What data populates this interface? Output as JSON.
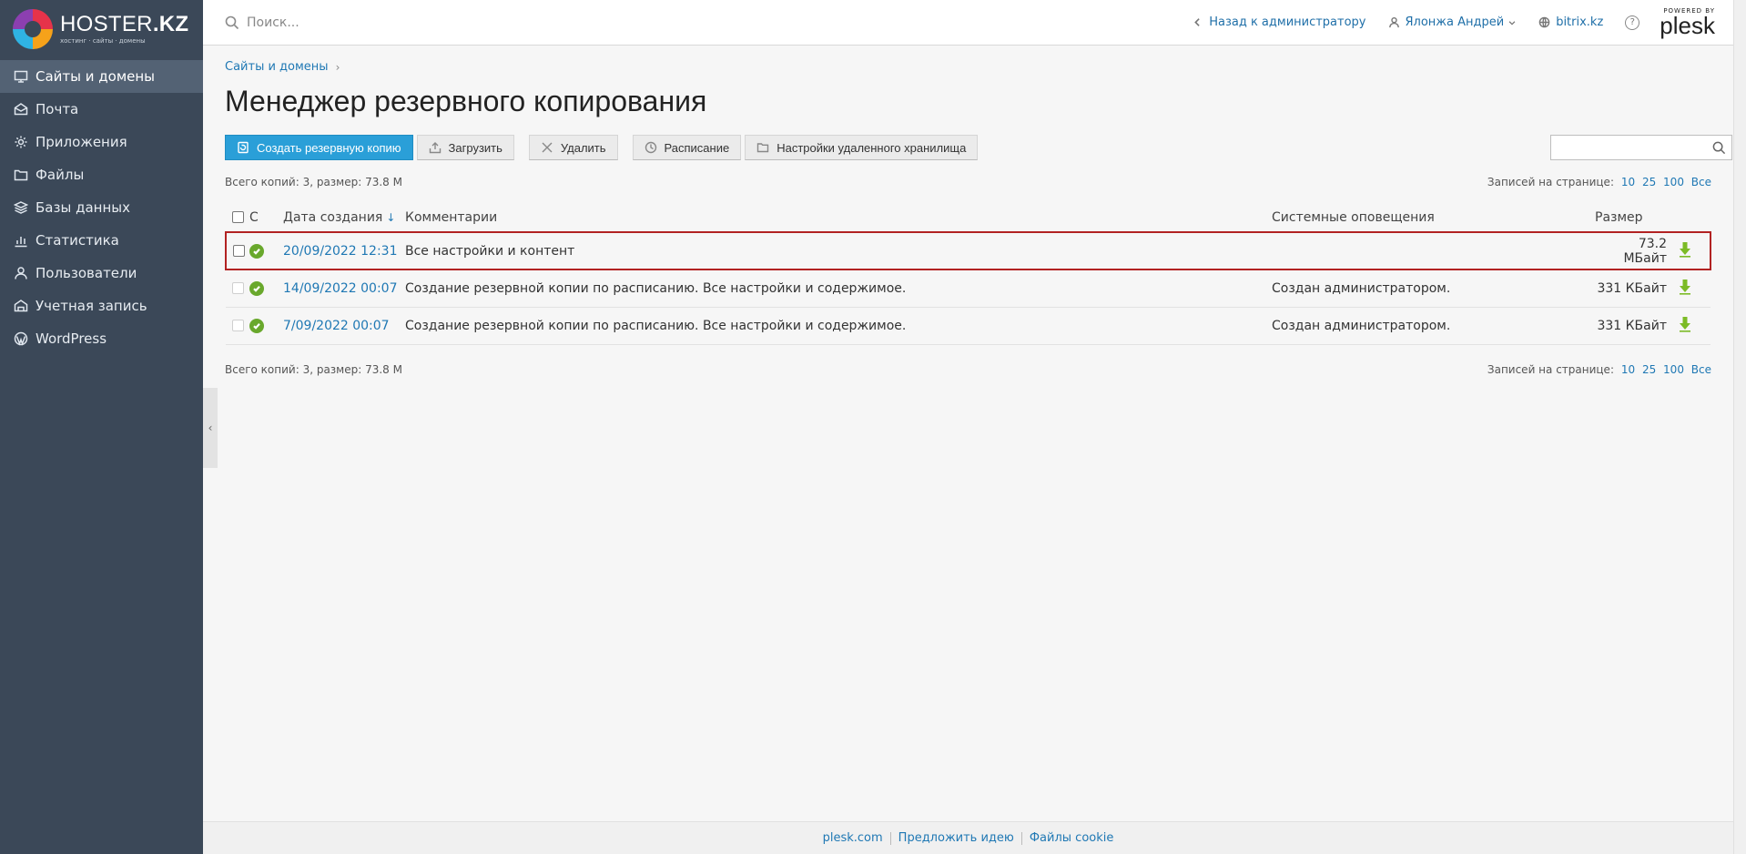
{
  "sidebar": {
    "logo": {
      "brand": "HOSTER",
      "brand_suffix": ".KZ",
      "tagline": "хостинг · сайты · домены"
    },
    "items": [
      {
        "label": "Сайты и домены",
        "icon": "monitor-icon",
        "active": true
      },
      {
        "label": "Почта",
        "icon": "mail-icon"
      },
      {
        "label": "Приложения",
        "icon": "gear-icon"
      },
      {
        "label": "Файлы",
        "icon": "folder-icon"
      },
      {
        "label": "Базы данных",
        "icon": "database-icon"
      },
      {
        "label": "Статистика",
        "icon": "chart-icon"
      },
      {
        "label": "Пользователи",
        "icon": "user-icon"
      },
      {
        "label": "Учетная запись",
        "icon": "account-icon"
      },
      {
        "label": "WordPress",
        "icon": "wordpress-icon"
      }
    ]
  },
  "topbar": {
    "search_placeholder": "Поиск...",
    "back_link": "Назад к администратору",
    "user": "Ялонжа Андрей",
    "domain": "bitrix.kz",
    "powered_by": "POWERED BY",
    "plesk": "plesk"
  },
  "breadcrumb": {
    "item": "Сайты и домены"
  },
  "page": {
    "title": "Менеджер резервного копирования"
  },
  "toolbar": {
    "create": "Создать резервную копию",
    "upload": "Загрузить",
    "delete": "Удалить",
    "schedule": "Расписание",
    "remote": "Настройки удаленного хранилища"
  },
  "summary": {
    "total": "Всего копий: 3, размер: 73.8 M",
    "per_page_label": "Записей на странице:",
    "per_page_options": [
      "10",
      "25",
      "100",
      "Все"
    ]
  },
  "table": {
    "headers": {
      "status": "С",
      "date": "Дата создания",
      "sort_arrow": "↓",
      "comments": "Комментарии",
      "notifications": "Системные оповещения",
      "size": "Размер"
    },
    "rows": [
      {
        "date": "20/09/2022 12:31",
        "comment": "Все настройки и контент",
        "notification": "",
        "size": "73.2 МБайт"
      },
      {
        "date": "14/09/2022 00:07",
        "comment": "Создание резервной копии по расписанию. Все настройки и содержимое.",
        "notification": "Создан администратором.",
        "size": "331 КБайт"
      },
      {
        "date": "7/09/2022 00:07",
        "comment": "Создание резервной копии по расписанию. Все настройки и содержимое.",
        "notification": "Создан администратором.",
        "size": "331 КБайт"
      }
    ]
  },
  "footer": {
    "links": [
      "plesk.com",
      "Предложить идею",
      "Файлы cookie"
    ]
  },
  "colors": {
    "accent": "#2a9fd8",
    "sidebar": "#3b4858",
    "ok": "#69a82c",
    "download": "#7cbb26",
    "highlight": "#b22222"
  }
}
